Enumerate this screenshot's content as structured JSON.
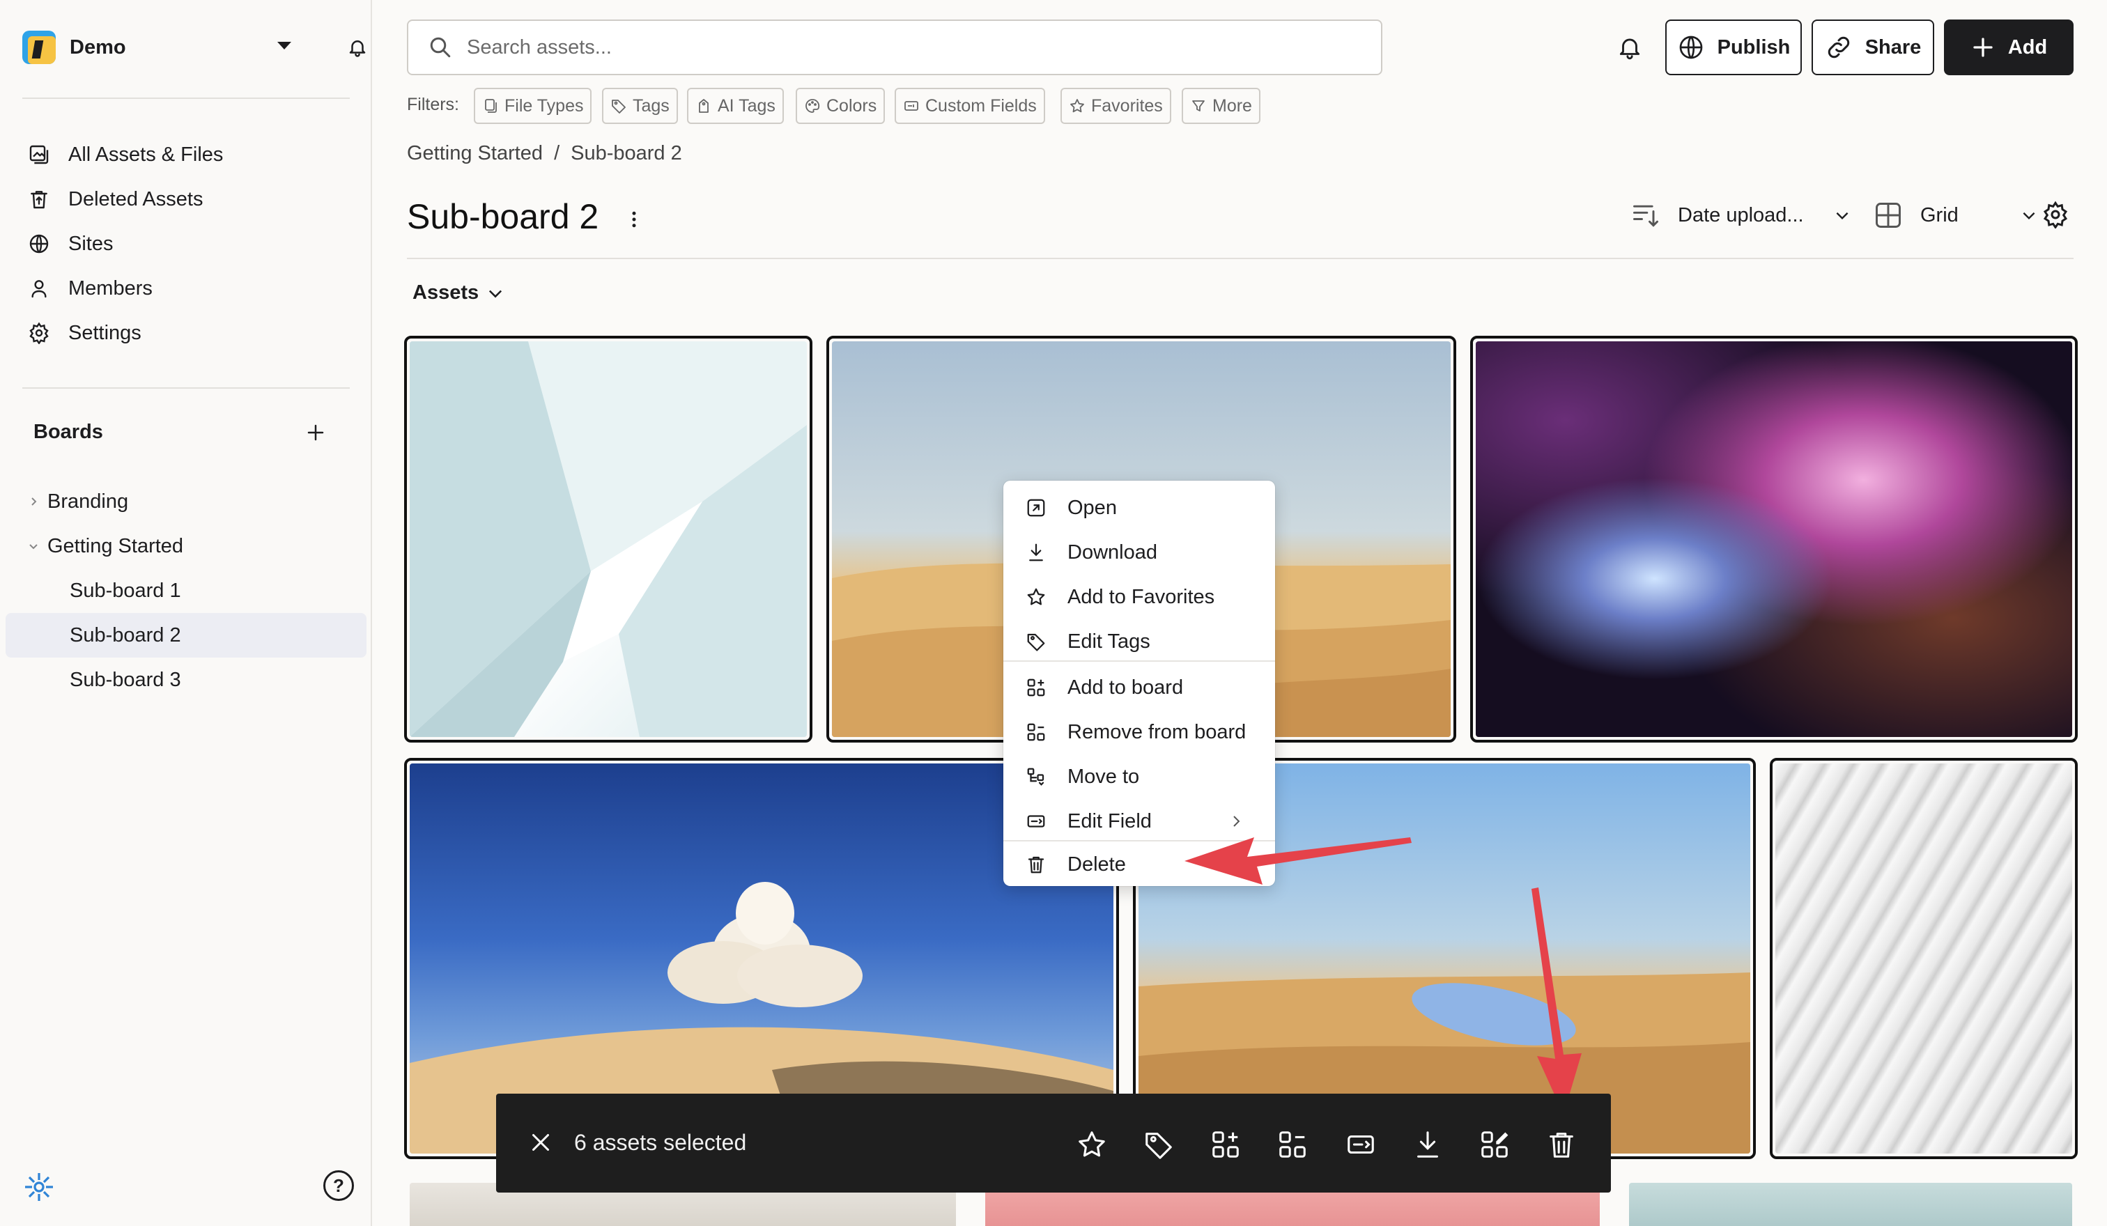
{
  "workspace": {
    "name": "Demo"
  },
  "sidebar": {
    "nav": [
      {
        "label": "All Assets & Files",
        "icon": "assets-icon"
      },
      {
        "label": "Deleted Assets",
        "icon": "trash-icon"
      },
      {
        "label": "Sites",
        "icon": "globe-icon"
      },
      {
        "label": "Members",
        "icon": "person-icon"
      },
      {
        "label": "Settings",
        "icon": "gear-icon"
      }
    ],
    "boards_heading": "Boards",
    "boards": [
      {
        "label": "Branding",
        "expanded": false
      },
      {
        "label": "Getting Started",
        "expanded": true
      }
    ],
    "sub_boards": [
      "Sub-board 1",
      "Sub-board 2",
      "Sub-board 3"
    ],
    "selected": "Sub-board 2"
  },
  "search": {
    "placeholder": "Search assets..."
  },
  "header": {
    "publish": "Publish",
    "share": "Share",
    "add": "Add"
  },
  "filters": {
    "label": "Filters:",
    "chips": [
      "File Types",
      "Tags",
      "AI Tags",
      "Colors",
      "Custom Fields",
      "Favorites",
      "More"
    ]
  },
  "breadcrumb": {
    "parent": "Getting Started",
    "separator": "/",
    "current": "Sub-board 2"
  },
  "page": {
    "title": "Sub-board 2",
    "sort": "Date upload...",
    "view": "Grid",
    "section": "Assets"
  },
  "context_menu": {
    "items": [
      {
        "label": "Open",
        "icon": "open-external-icon"
      },
      {
        "label": "Download",
        "icon": "download-icon"
      },
      {
        "label": "Add to Favorites",
        "icon": "star-icon"
      },
      {
        "label": "Edit Tags",
        "icon": "tag-icon"
      },
      {
        "label": "Add to board",
        "icon": "add-to-board-icon"
      },
      {
        "label": "Remove from board",
        "icon": "remove-from-board-icon"
      },
      {
        "label": "Move to",
        "icon": "move-icon"
      },
      {
        "label": "Edit Field",
        "icon": "field-icon"
      },
      {
        "label": "Delete",
        "icon": "trash-icon"
      }
    ]
  },
  "selection_bar": {
    "text": "6 assets selected",
    "actions": [
      "star-icon",
      "tag-icon",
      "add-to-board-icon",
      "remove-from-board-icon",
      "field-icon",
      "download-icon",
      "edit-boards-icon",
      "trash-icon"
    ]
  },
  "colors": {
    "accent_dark": "#1d1d1f",
    "annotation_arrow": "#e5424a",
    "selected_bg": "#ecedf3"
  }
}
